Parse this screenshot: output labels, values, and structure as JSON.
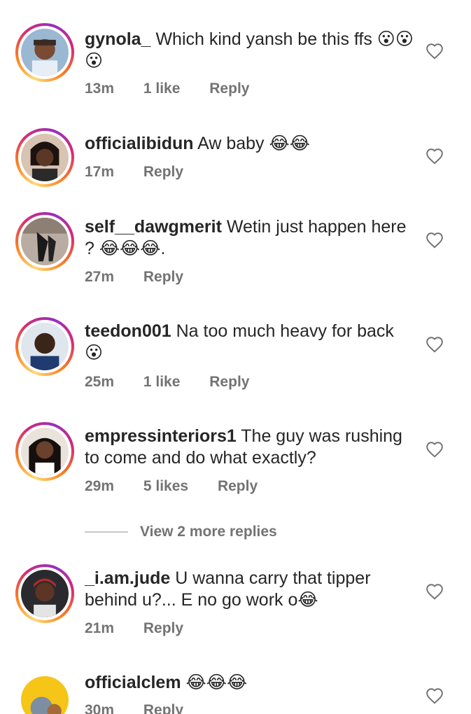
{
  "comments": [
    {
      "username": "gynola_",
      "text": "Which kind yansh be this ffs 😮😮😮",
      "time": "13m",
      "likes": "1 like",
      "reply": "Reply"
    },
    {
      "username": "officialibidun",
      "text": "Aw baby 😂😂",
      "time": "17m",
      "likes": "",
      "reply": "Reply"
    },
    {
      "username": "self__dawgmerit",
      "text": "Wetin just happen here ? 😂😂😂.",
      "time": "27m",
      "likes": "",
      "reply": "Reply"
    },
    {
      "username": "teedon001",
      "text": "Na too much heavy for back 😮",
      "time": "25m",
      "likes": "1 like",
      "reply": "Reply"
    },
    {
      "username": "empressinteriors1",
      "text": "The guy was rushing to come and do what exactly?",
      "time": "29m",
      "likes": "5 likes",
      "reply": "Reply"
    },
    {
      "username": "_i.am.jude",
      "text": "U wanna carry that tipper behind u?... E no go work o😂",
      "time": "21m",
      "likes": "",
      "reply": "Reply"
    },
    {
      "username": "officialclem",
      "text": "😂😂😂",
      "time": "30m",
      "likes": "",
      "reply": "Reply"
    }
  ],
  "view_more": "View 2 more replies",
  "colors": {
    "text": "#262626",
    "secondary": "#737373",
    "ring_gradient": [
      "#feda75",
      "#fa7e1e",
      "#d62976",
      "#962fbf"
    ]
  },
  "icons": {
    "heart": "heart-outline-icon"
  }
}
